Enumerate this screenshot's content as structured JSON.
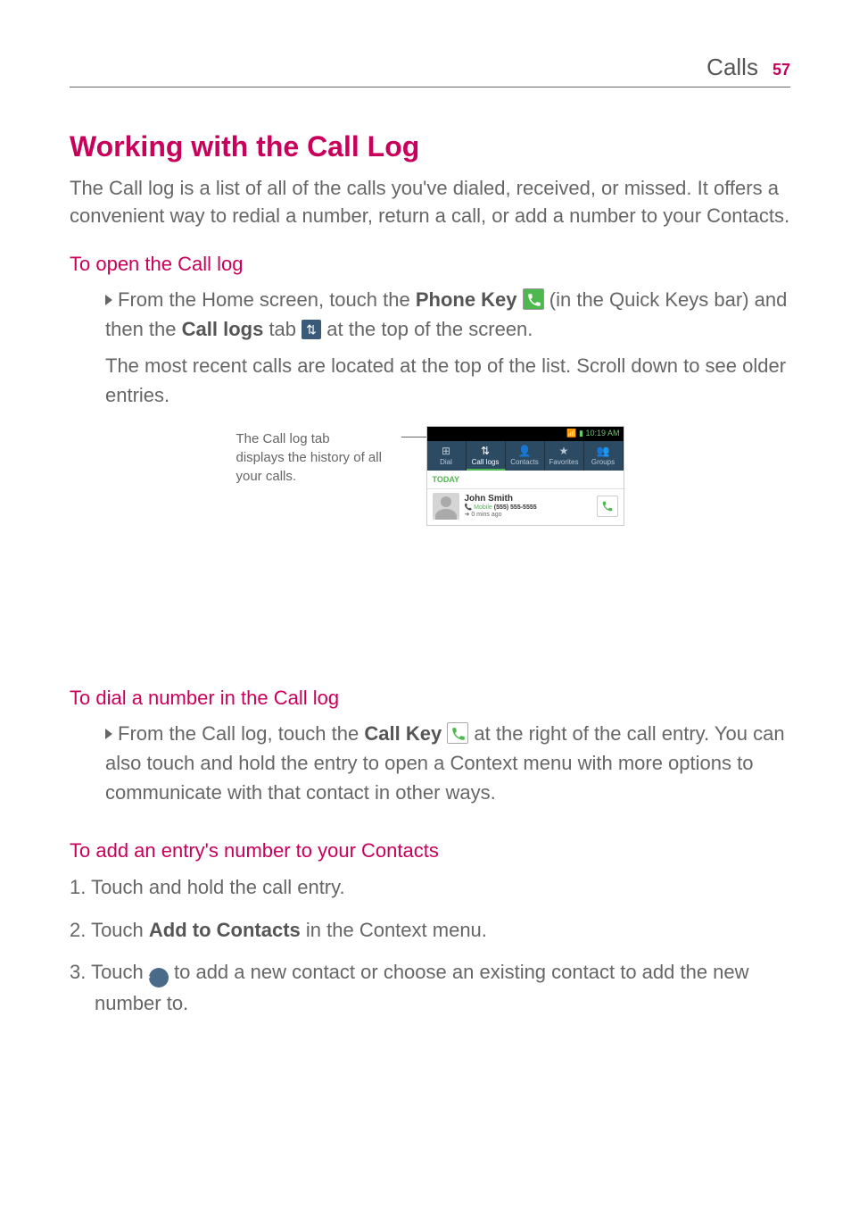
{
  "header": {
    "section": "Calls",
    "page": "57"
  },
  "h1": "Working with the Call Log",
  "intro": "The Call log is a list of all of the calls you've dialed, received, or missed. It offers a convenient way to redial a number, return a call, or add a number to your Contacts.",
  "sec1": {
    "heading": "To open the Call log",
    "step1_a": "From the Home screen, touch the ",
    "step1_b": "Phone Key",
    "step1_c": " (in the Quick Keys bar) and then the ",
    "step1_d": "Call logs",
    "step1_e": " tab ",
    "step1_f": " at the top of the screen.",
    "step1_note": "The most recent calls are located at the top of the list. Scroll down to see older entries."
  },
  "callout": {
    "line1": "The Call log tab",
    "line2": "displays the history of all your calls."
  },
  "screenshot": {
    "time": "10:19 AM",
    "status_icons": "◉ ▮▮▮ ▮",
    "tabs": {
      "dial": "Dial",
      "call_logs": "Call logs",
      "contacts": "Contacts",
      "favorites": "Favorites",
      "groups": "Groups"
    },
    "today": "TODAY",
    "entry": {
      "name": "John Smith",
      "type": "Mobile",
      "number": "(555) 555-5555",
      "ago": "0 mins ago"
    }
  },
  "sec2": {
    "heading": "To dial a number in the Call log",
    "step_a": "From the Call log, touch the ",
    "step_b": "Call Key",
    "step_c": " at the right of the call entry. You can also touch and hold the entry to open a Context menu with more options to communicate with that contact in other ways."
  },
  "sec3": {
    "heading": "To add an entry's number to your Contacts",
    "n1": "1. Touch and hold the call entry.",
    "n2_a": "2. Touch ",
    "n2_b": "Add to Contacts",
    "n2_c": " in the Context menu.",
    "n3_a": "3. Touch ",
    "n3_b": " to add a new contact or choose an existing contact to add the new number to."
  }
}
